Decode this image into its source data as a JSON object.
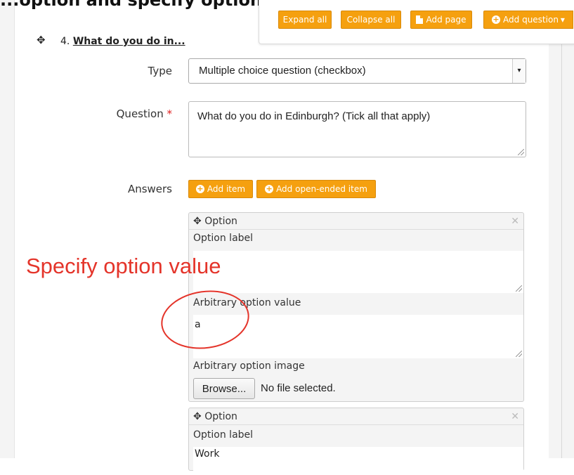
{
  "banner": {
    "partial_title": "...option and specify options"
  },
  "toolbar": {
    "expand_all": "Expand all",
    "collapse_all": "Collapse all",
    "add_page": "Add page",
    "add_question": "Add question",
    "add_question_caret": "▾"
  },
  "question": {
    "number": "4.",
    "title": "What do you do in...",
    "type_label": "Type",
    "type_value": "Multiple choice question (checkbox)",
    "question_label": "Question",
    "required_mark": "*",
    "question_value": "What do you do in Edinburgh? (Tick all that apply)",
    "answers_label": "Answers",
    "add_item": "Add item",
    "add_open_ended_item": "Add open-ended item"
  },
  "options": [
    {
      "header": "Option",
      "label_heading": "Option label",
      "label_value": "",
      "value_heading": "Arbitrary option value",
      "value_value": "a",
      "image_heading": "Arbitrary option image",
      "browse_label": "Browse...",
      "file_status": "No file selected."
    },
    {
      "header": "Option",
      "label_heading": "Option label",
      "label_value": "Work"
    }
  ],
  "annotation": {
    "text": "Specify option value",
    "color": "#e4342a"
  },
  "colors": {
    "accent": "#f5a00f",
    "required": "#e02020"
  },
  "icons": {
    "move": "move-icon",
    "close": "close-icon",
    "add": "plus-circle-icon",
    "page": "file-icon"
  }
}
